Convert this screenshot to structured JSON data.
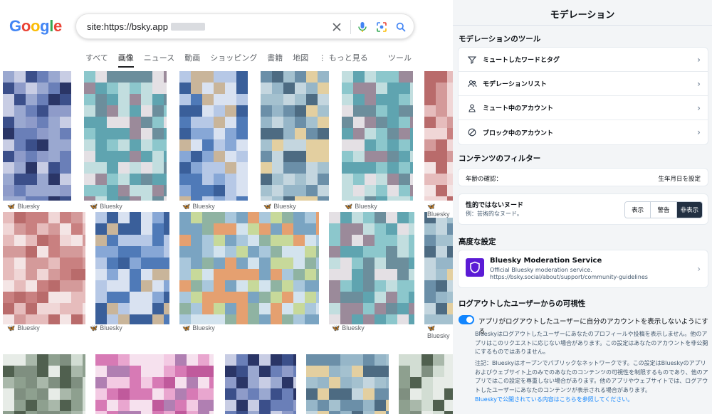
{
  "google": {
    "logo_letters": [
      "G",
      "o",
      "o",
      "g",
      "l",
      "e"
    ],
    "logo_colors": [
      "#4285f4",
      "#ea4335",
      "#fbbc05",
      "#4285f4",
      "#34a853",
      "#ea4335"
    ],
    "search_value": "site:https://bsky.app",
    "tabs": [
      {
        "label": "すべて",
        "active": false
      },
      {
        "label": "画像",
        "active": true
      },
      {
        "label": "ニュース",
        "active": false
      },
      {
        "label": "動画",
        "active": false
      },
      {
        "label": "ショッピング",
        "active": false
      },
      {
        "label": "書籍",
        "active": false
      },
      {
        "label": "地図",
        "active": false
      },
      {
        "label": "⋮ もっと見る",
        "active": false
      }
    ],
    "tools_label": "ツール",
    "source_label": "Bluesky",
    "icons": [
      "clear-icon",
      "mic-icon",
      "lens-icon",
      "search-icon"
    ]
  },
  "moderation": {
    "title": "モデレーション",
    "tools_heading": "モデレーションのツール",
    "tools_items": [
      {
        "label": "ミュートしたワードとタグ",
        "icon": "filter-icon"
      },
      {
        "label": "モデレーションリスト",
        "icon": "people-icon"
      },
      {
        "label": "ミュート中のアカウント",
        "icon": "person-icon"
      },
      {
        "label": "ブロック中のアカウント",
        "icon": "block-icon"
      }
    ],
    "filter_heading": "コンテンツのフィルター",
    "age_label": "年齢の確認：",
    "age_action": "生年月日を設定",
    "nudity_title": "性的ではないヌード",
    "nudity_example": "例：芸術的なヌード。",
    "nudity_options": [
      "表示",
      "警告",
      "非表示"
    ],
    "nudity_selected": "非表示",
    "advanced_heading": "高度な設定",
    "service_name": "Bluesky Moderation Service",
    "service_desc": "Official Bluesky moderation service.",
    "service_url": "https://bsky.social/about/support/community-guidelines",
    "visibility_heading": "ログアウトしたユーザーからの可視性",
    "toggle_label": "アプリがログアウトしたユーザーに自分のアカウントを表示しないようにする",
    "toggle_on": true,
    "para1": "Blueskyはログアウトしたユーザーにあなたのプロフィールや投稿を表示しません。他のアプリはこのリクエストに応じない場合があります。この設定はあなたのアカウントを非公開にするものではありません。",
    "para2": "注記：Blueskyはオープンでパブリックなネットワークです。この設定はBlueskyのアプリおよびウェブサイト上のみでのあなたのコンテンツの可視性を制限するものであり、他のアプリではこの設定を尊重しない場合があります。他のアプリやウェブサイトでは、ログアウトしたユーザーにあなたのコンテンツが表示される場合があります。",
    "link_text": "Blueskyで公開されている内容はこちらを参照してください。",
    "accent_color": "#1185fe",
    "service_color": "#5b1bd5"
  }
}
